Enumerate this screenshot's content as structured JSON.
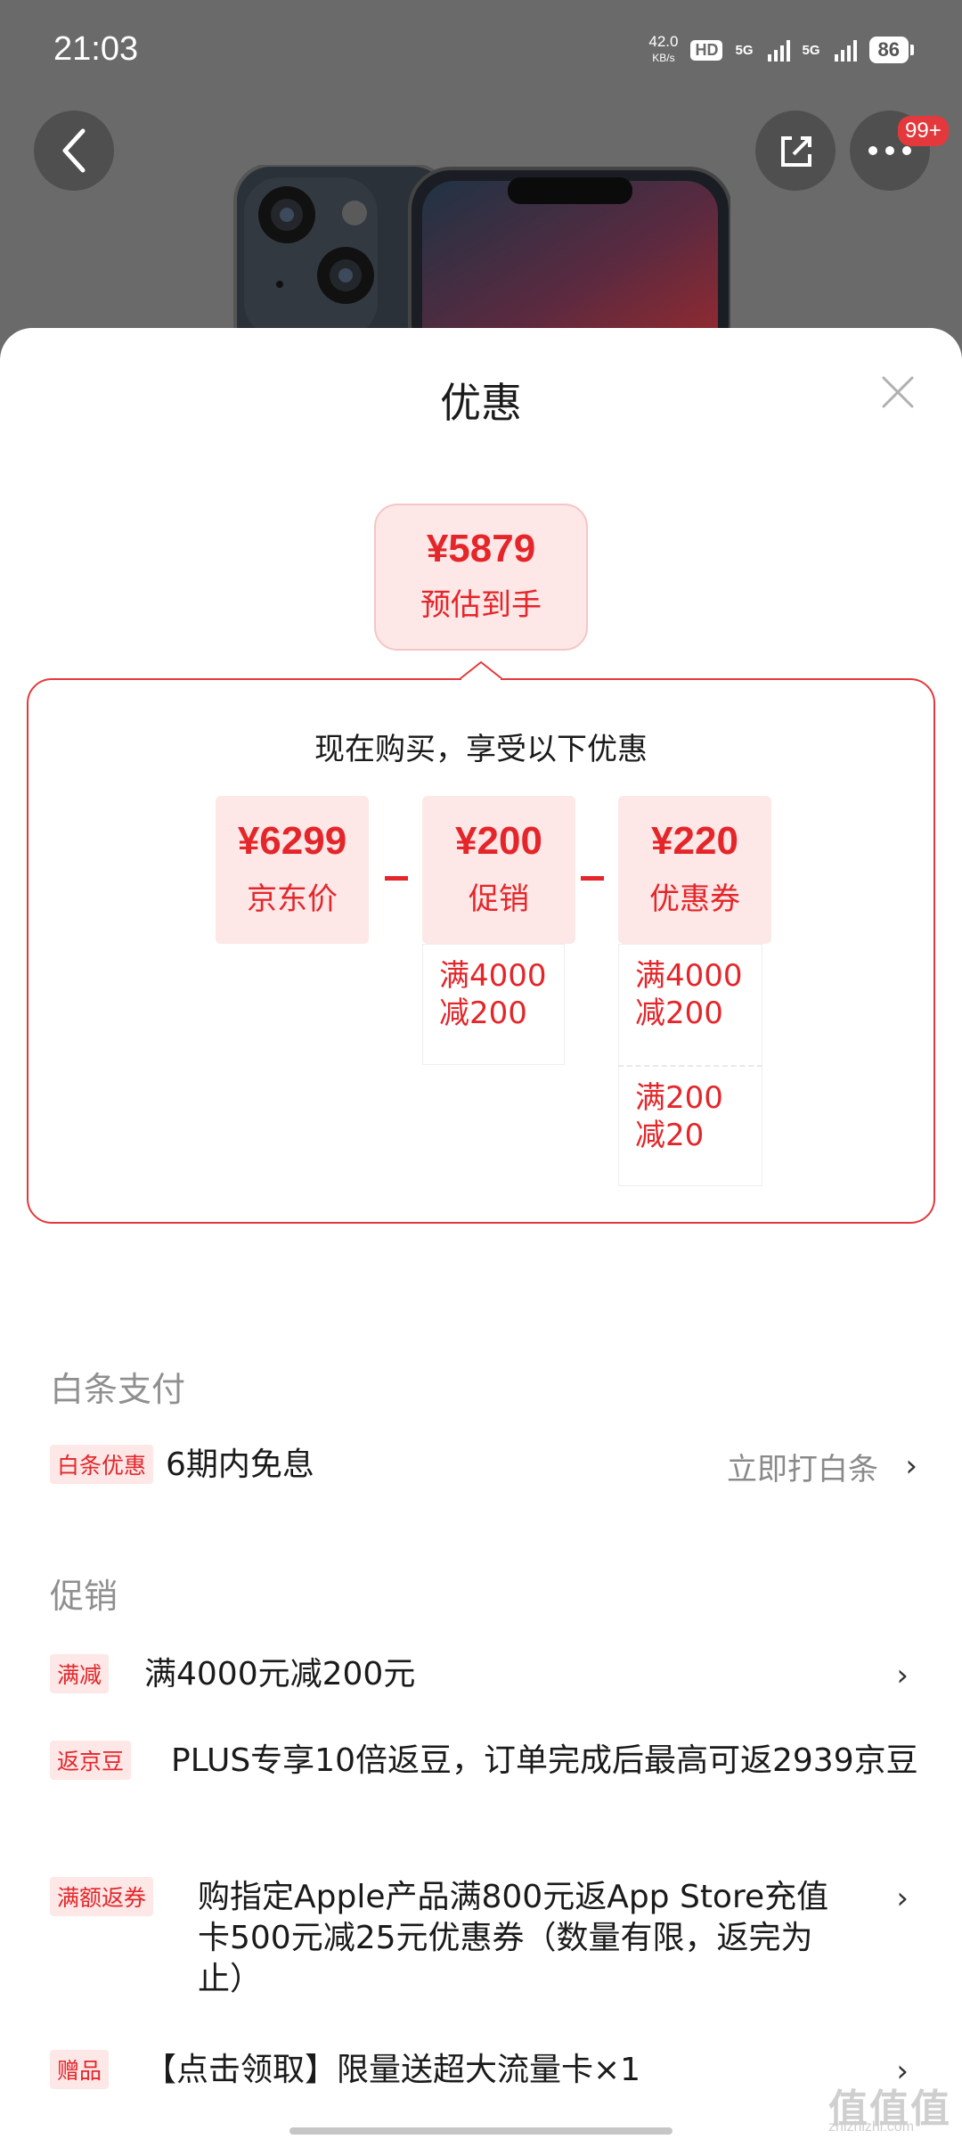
{
  "status_bar": {
    "time": "21:03",
    "net_speed": "42.0",
    "net_speed_unit": "KB/s",
    "hd_label": "HD",
    "sim1": "5G",
    "sim2": "5G",
    "battery": "86"
  },
  "header": {
    "more_badge": "99+"
  },
  "sheet": {
    "title": "优惠",
    "estimate": {
      "price": "¥5879",
      "label": "预估到手"
    },
    "breakdown": {
      "heading": "现在购买，享受以下优惠",
      "items": [
        {
          "value": "¥6299",
          "label": "京东价"
        },
        {
          "value": "¥200",
          "label": "促销"
        },
        {
          "value": "¥220",
          "label": "优惠券"
        }
      ],
      "promo_rules": [
        "满4000减200"
      ],
      "coupon_rules": [
        "满4000减200",
        "满200减20"
      ]
    }
  },
  "baitiao": {
    "section_title": "白条支付",
    "tag": "白条优惠",
    "text": "6期内免息",
    "action": "立即打白条"
  },
  "promotions": {
    "section_title": "促销",
    "items": [
      {
        "tag": "满减",
        "text": "满4000元减200元"
      },
      {
        "tag": "返京豆",
        "text": "PLUS专享10倍返豆，订单完成后最高可返2939京豆"
      },
      {
        "tag": "满额返券",
        "text": "购指定Apple产品满800元返App Store充值卡500元减25元优惠券（数量有限，返完为止）"
      },
      {
        "tag": "赠品",
        "text": "【点击领取】限量送超大流量卡×1"
      }
    ]
  },
  "watermark": {
    "main": "值值值",
    "sub": "zhizhizhi.com"
  }
}
